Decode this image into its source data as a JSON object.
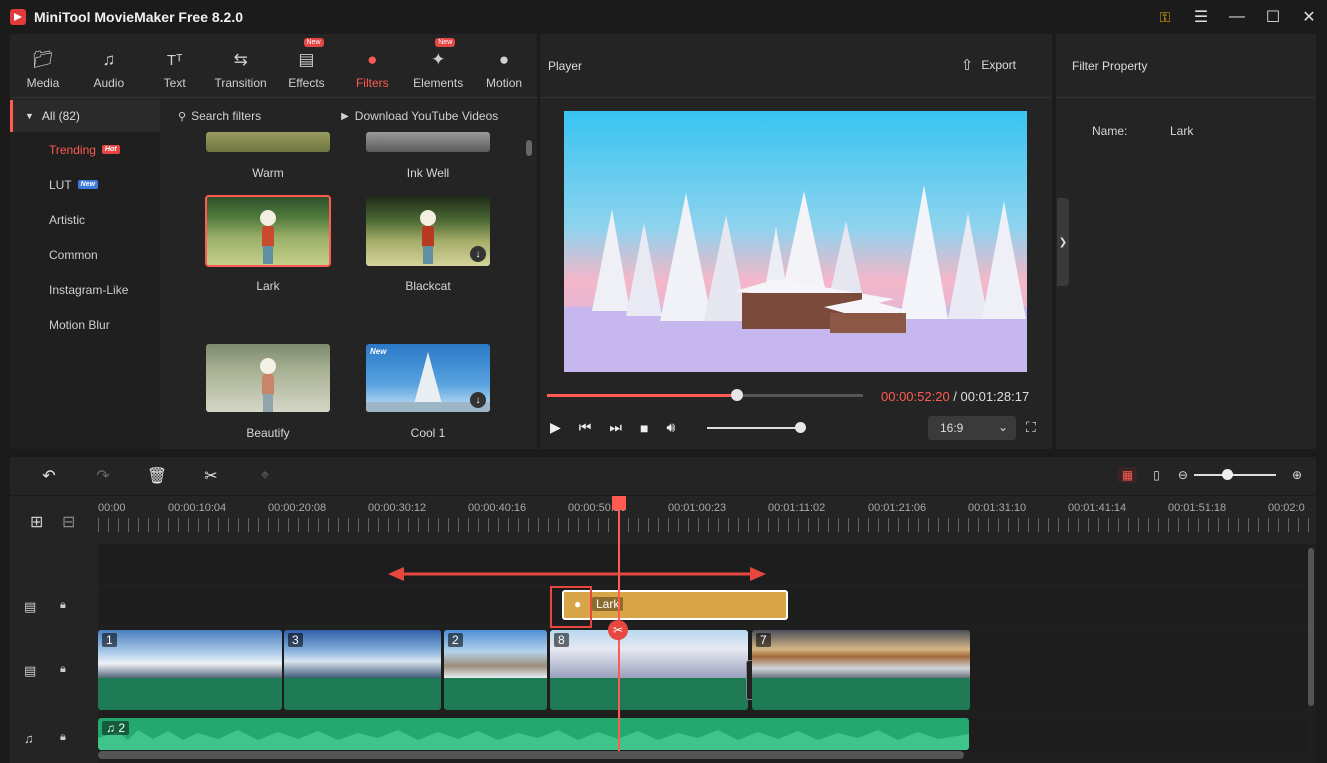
{
  "app": {
    "title": "MiniTool MovieMaker Free 8.2.0"
  },
  "media_tabs": [
    {
      "label": "Media",
      "icon": "folder-icon",
      "new": false
    },
    {
      "label": "Audio",
      "icon": "music-icon",
      "new": false
    },
    {
      "label": "Text",
      "icon": "text-icon",
      "new": false
    },
    {
      "label": "Transition",
      "icon": "transition-icon",
      "new": false
    },
    {
      "label": "Effects",
      "icon": "effects-icon",
      "new": true
    },
    {
      "label": "Filters",
      "icon": "filters-icon",
      "new": false
    },
    {
      "label": "Elements",
      "icon": "elements-icon",
      "new": true
    },
    {
      "label": "Motion",
      "icon": "motion-icon",
      "new": false
    }
  ],
  "new_badge": "New",
  "categories": {
    "all": "All (82)",
    "items": [
      {
        "label": "Trending",
        "badge": "Hot"
      },
      {
        "label": "LUT",
        "badge": "New"
      },
      {
        "label": "Artistic",
        "badge": ""
      },
      {
        "label": "Common",
        "badge": ""
      },
      {
        "label": "Instagram-Like",
        "badge": ""
      },
      {
        "label": "Motion Blur",
        "badge": ""
      }
    ]
  },
  "filters": {
    "search_placeholder": "Search filters",
    "download_youtube": "Download YouTube Videos",
    "items": [
      {
        "label": "Warm"
      },
      {
        "label": "Ink Well"
      },
      {
        "label": "Lark",
        "selected": true
      },
      {
        "label": "Blackcat"
      },
      {
        "label": "Beautify"
      },
      {
        "label": "Cool 1",
        "new_label": "New"
      }
    ]
  },
  "player": {
    "title": "Player",
    "export_label": "Export",
    "current_time": "00:00:52:20",
    "total_time": " / 00:01:28:17",
    "progress": 0.6,
    "volume": 0.98,
    "aspect_ratio": "16:9"
  },
  "property": {
    "title": "Filter Property",
    "name_label": "Name:",
    "name_value": "Lark"
  },
  "timeline": {
    "ruler": [
      "00:00",
      "00:00:10:04",
      "00:00:20:08",
      "00:00:30:12",
      "00:00:40:16",
      "00:00:50:20",
      "00:01:00:23",
      "00:01:11:02",
      "00:01:21:06",
      "00:01:31:10",
      "00:01:41:14",
      "00:01:51:18",
      "00:02:0"
    ],
    "filter_clip": "Lark",
    "video_clips": [
      "1",
      "3",
      "2",
      "8",
      "7"
    ],
    "audio_clip": "2",
    "zoom": 0.4
  },
  "colors": {
    "accent": "#ff5b52",
    "video_track": "#1e7a55",
    "audio_track": "#25a870",
    "filter_clip": "#d8a646"
  }
}
